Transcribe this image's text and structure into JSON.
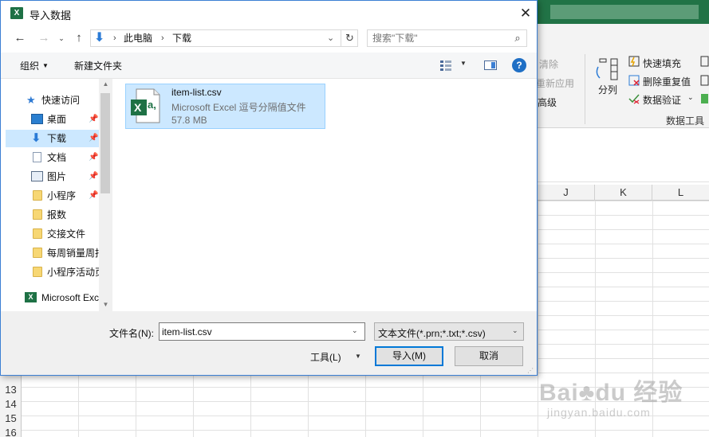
{
  "excel": {
    "ribbon": {
      "clear": "清除",
      "reapply": "重新应用",
      "advanced": "高级",
      "split": "分列",
      "flash_fill": "快速填充",
      "remove_duplicates": "删除重复值",
      "data_validation": "数据验证",
      "data_tools_label": "数据工具"
    },
    "columns": [
      "J",
      "K",
      "L"
    ],
    "rows": [
      "13",
      "14",
      "15",
      "16"
    ]
  },
  "dialog": {
    "title": "导入数据",
    "close_glyph": "✕",
    "breadcrumbs": [
      "此电脑",
      "下载"
    ],
    "search_placeholder": "搜索\"下载\"",
    "toolbar": {
      "organize": "组织",
      "new_folder": "新建文件夹",
      "help": "?"
    },
    "nav": {
      "quick_access": "快速访问",
      "items": [
        {
          "label": "桌面",
          "icon": "desktop-icon",
          "pinned": true
        },
        {
          "label": "下载",
          "icon": "download-icon",
          "pinned": true,
          "selected": true
        },
        {
          "label": "文档",
          "icon": "document-icon",
          "pinned": true
        },
        {
          "label": "图片",
          "icon": "picture-icon",
          "pinned": true
        },
        {
          "label": "小程序",
          "icon": "folder-icon",
          "pinned": true
        },
        {
          "label": "报数",
          "icon": "folder-icon"
        },
        {
          "label": "交接文件",
          "icon": "folder-icon"
        },
        {
          "label": "每周销量周报",
          "icon": "folder-icon"
        },
        {
          "label": "小程序活动页",
          "icon": "folder-icon"
        }
      ],
      "app_item": "Microsoft Excel"
    },
    "file": {
      "name": "item-list.csv",
      "type": "Microsoft Excel 逗号分隔值文件",
      "size": "57.8 MB",
      "icon_letter": "X",
      "icon_suffix": "a,"
    },
    "filename_label": "文件名(N):",
    "filename_value": "item-list.csv",
    "filetype_value": "文本文件(*.prn;*.txt;*.csv)",
    "tools_label": "工具(L)",
    "import_label": "导入(M)",
    "cancel_label": "取消"
  },
  "colors": {
    "excel_green": "#217346",
    "selection": "#cce8ff",
    "accent": "#0078d7"
  }
}
